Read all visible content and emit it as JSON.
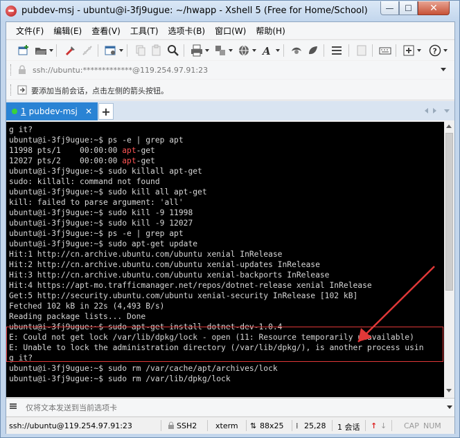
{
  "window": {
    "title": "pubdev-msj - ubuntu@i-3fj9ugue: ~/hwapp - Xshell 5 (Free for Home/School)",
    "min_glyph": "—",
    "max_glyph": "☐",
    "close_glyph": "✕"
  },
  "menu": [
    {
      "id": "file",
      "label": "文件(F)"
    },
    {
      "id": "edit",
      "label": "编辑(E)"
    },
    {
      "id": "view",
      "label": "查看(V)"
    },
    {
      "id": "tools",
      "label": "工具(T)"
    },
    {
      "id": "tab",
      "label": "选项卡(B)"
    },
    {
      "id": "window",
      "label": "窗口(W)"
    },
    {
      "id": "help",
      "label": "帮助(H)"
    }
  ],
  "address": {
    "value": "ssh://ubuntu:*************@119.254.97.91:23"
  },
  "hint": {
    "text": "要添加当前会话，点击左侧的箭头按钮。"
  },
  "tabs": {
    "active": {
      "number": "1",
      "label": "pubdev-msj",
      "close": "✕"
    },
    "add": "+"
  },
  "terminal": {
    "lines": [
      "g it?",
      "ubuntu@i-3fj9ugue:~$ ps -e | grep apt",
      "11998 pts/1    00:00:00 apt-get",
      "12027 pts/2    00:00:00 apt-get",
      "ubuntu@i-3fj9ugue:~$ sudo killall apt-get",
      "sudo: killall: command not found",
      "ubuntu@i-3fj9ugue:~$ sudo kill all apt-get",
      "kill: failed to parse argument: 'all'",
      "ubuntu@i-3fj9ugue:~$ sudo kill -9 11998",
      "ubuntu@i-3fj9ugue:~$ sudo kill -9 12027",
      "ubuntu@i-3fj9ugue:~$ ps -e | grep apt",
      "ubuntu@i-3fj9ugue:~$ sudo apt-get update",
      "Hit:1 http://cn.archive.ubuntu.com/ubuntu xenial InRelease",
      "Hit:2 http://cn.archive.ubuntu.com/ubuntu xenial-updates InRelease",
      "Hit:3 http://cn.archive.ubuntu.com/ubuntu xenial-backports InRelease",
      "Hit:4 https://apt-mo.trafficmanager.net/repos/dotnet-release xenial InRelease",
      "Get:5 http://security.ubuntu.com/ubuntu xenial-security InRelease [102 kB]",
      "Fetched 102 kB in 22s (4,493 B/s)",
      "Reading package lists... Done",
      "ubuntu@i-3fj9ugue:~$ sudo apt-get install dotnet-dev-1.0.4",
      "E: Could not get lock /var/lib/dpkg/lock - open (11: Resource temporarily unavailable)",
      "E: Unable to lock the administration directory (/var/lib/dpkg/), is another process usin",
      "g it?",
      "ubuntu@i-3fj9ugue:~$ sudo rm /var/cache/apt/archives/lock",
      "ubuntu@i-3fj9ugue:~$ sudo rm /var/lib/dpkg/lock"
    ],
    "highlight_word": "apt"
  },
  "compose": {
    "placeholder": "仅将文本发送到当前选项卡"
  },
  "status": {
    "connection": "ssh://ubuntu@119.254.97.91:23",
    "protocol": "SSH2",
    "terminal_type": "xterm",
    "size": "88x25",
    "cursor": "25,28",
    "sessions": "1 会话",
    "caps": "CAP",
    "num": "NUM"
  },
  "colors": {
    "tab_active": "#2a83d4",
    "annotation_red": "#e13838",
    "grep_match": "#ff5555"
  }
}
